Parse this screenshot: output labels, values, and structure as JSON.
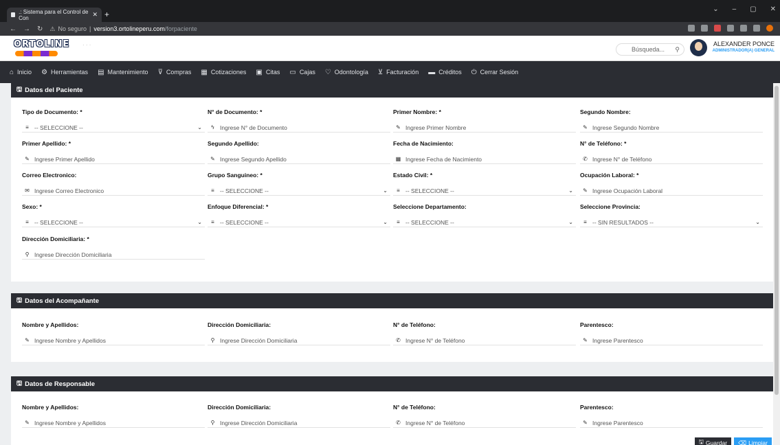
{
  "browser": {
    "tab_title": ".: Sistema para el Control de Con",
    "security": "No seguro",
    "host": "version3.ortolineperu.com",
    "path": "/forpaciente"
  },
  "header": {
    "logo_text": "ORTOLINE",
    "search_placeholder": "Búsqueda...",
    "user_name": "ALEXANDER PONCE",
    "user_role": "ADMINISTRADOR(A) GENERAL"
  },
  "menu": [
    {
      "label": "Inicio",
      "icon": "home-icon",
      "glyph": "⌂"
    },
    {
      "label": "Herramientas",
      "icon": "gear-icon",
      "glyph": "⚙"
    },
    {
      "label": "Mantenimiento",
      "icon": "book-icon",
      "glyph": "▤"
    },
    {
      "label": "Compras",
      "icon": "cart-icon",
      "glyph": "⊽"
    },
    {
      "label": "Cotizaciones",
      "icon": "quote-icon",
      "glyph": "▦"
    },
    {
      "label": "Citas",
      "icon": "calendar-icon",
      "glyph": "▣"
    },
    {
      "label": "Cajas",
      "icon": "monitor-icon",
      "glyph": "▭"
    },
    {
      "label": "Odontología",
      "icon": "tooth-icon",
      "glyph": "♡"
    },
    {
      "label": "Facturación",
      "icon": "basket-icon",
      "glyph": "⊻"
    },
    {
      "label": "Créditos",
      "icon": "card-icon",
      "glyph": "▬"
    },
    {
      "label": "Cerrar Sesión",
      "icon": "power-icon",
      "glyph": "⏻"
    }
  ],
  "paciente": {
    "title": "Datos del Paciente",
    "fields": [
      {
        "label": "Tipo de Documento: *",
        "value": "-- SELECCIONE --",
        "icon": "list-icon",
        "glyph": "≡",
        "select": true
      },
      {
        "label": "N° de Documento: *",
        "value": "Ingrese N° de Documento",
        "icon": "bolt-icon",
        "glyph": "ϟ"
      },
      {
        "label": "Primer Nombre: *",
        "value": "Ingrese Primer Nombre",
        "icon": "pencil-icon",
        "glyph": "✎"
      },
      {
        "label": "Segundo Nombre:",
        "value": "Ingrese Segundo Nombre",
        "icon": "pencil-icon",
        "glyph": "✎"
      },
      {
        "label": "Primer Apellido: *",
        "value": "Ingrese Primer Apellido",
        "icon": "pencil-icon",
        "glyph": "✎"
      },
      {
        "label": "Segundo Apellido:",
        "value": "Ingrese Segundo Apellido",
        "icon": "pencil-icon",
        "glyph": "✎"
      },
      {
        "label": "Fecha de Nacimiento:",
        "value": "Ingrese Fecha de Nacimiento",
        "icon": "calendar-icon",
        "glyph": "▦"
      },
      {
        "label": "N° de Teléfono: *",
        "value": "Ingrese N° de Teléfono",
        "icon": "phone-icon",
        "glyph": "✆"
      },
      {
        "label": "Correo Electronico:",
        "value": "Ingrese Correo Electronico",
        "icon": "envelope-icon",
        "glyph": "✉"
      },
      {
        "label": "Grupo Sanguineo: *",
        "value": "-- SELECCIONE --",
        "icon": "list-icon",
        "glyph": "≡",
        "select": true
      },
      {
        "label": "Estado Civil: *",
        "value": "-- SELECCIONE --",
        "icon": "list-icon",
        "glyph": "≡",
        "select": true
      },
      {
        "label": "Ocupación Laboral: *",
        "value": "Ingrese Ocupación Laboral",
        "icon": "pencil-icon",
        "glyph": "✎"
      },
      {
        "label": "Sexo: *",
        "value": "-- SELECCIONE --",
        "icon": "list-icon",
        "glyph": "≡",
        "select": true
      },
      {
        "label": "Enfoque Diferencial: *",
        "value": "-- SELECCIONE --",
        "icon": "list-icon",
        "glyph": "≡",
        "select": true
      },
      {
        "label": "Seleccione Departamento:",
        "value": "-- SELECCIONE --",
        "icon": "list-icon",
        "glyph": "≡",
        "select": true
      },
      {
        "label": "Seleccione Provincia:",
        "value": "-- SIN RESULTADOS --",
        "icon": "list-icon",
        "glyph": "≡",
        "select": true
      },
      {
        "label": "Dirección Domiciliaria: *",
        "value": "Ingrese Dirección Domiciliaria",
        "icon": "pin-icon",
        "glyph": "⚲"
      }
    ]
  },
  "acompanante": {
    "title": "Datos del Acompañante",
    "fields": [
      {
        "label": "Nombre y Apellidos:",
        "value": "Ingrese Nombre y Apellidos",
        "icon": "pencil-icon",
        "glyph": "✎"
      },
      {
        "label": "Dirección Domiciliaria:",
        "value": "Ingrese Dirección Domiciliaria",
        "icon": "pin-icon",
        "glyph": "⚲"
      },
      {
        "label": "N° de Teléfono:",
        "value": "Ingrese N° de Teléfono",
        "icon": "phone-icon",
        "glyph": "✆"
      },
      {
        "label": "Parentesco:",
        "value": "Ingrese Parentesco",
        "icon": "pencil-icon",
        "glyph": "✎"
      }
    ]
  },
  "responsable": {
    "title": "Datos de Responsable",
    "fields": [
      {
        "label": "Nombre y Apellidos:",
        "value": "Ingrese Nombre y Apellidos",
        "icon": "pencil-icon",
        "glyph": "✎"
      },
      {
        "label": "Dirección Domiciliaria:",
        "value": "Ingrese Dirección Domiciliaria",
        "icon": "pin-icon",
        "glyph": "⚲"
      },
      {
        "label": "N° de Teléfono:",
        "value": "Ingrese N° de Teléfono",
        "icon": "phone-icon",
        "glyph": "✆"
      },
      {
        "label": "Parentesco:",
        "value": "Ingrese Parentesco",
        "icon": "pencil-icon",
        "glyph": "✎"
      }
    ]
  },
  "actions": {
    "save": "Guardar",
    "clear": "Limpiar"
  }
}
